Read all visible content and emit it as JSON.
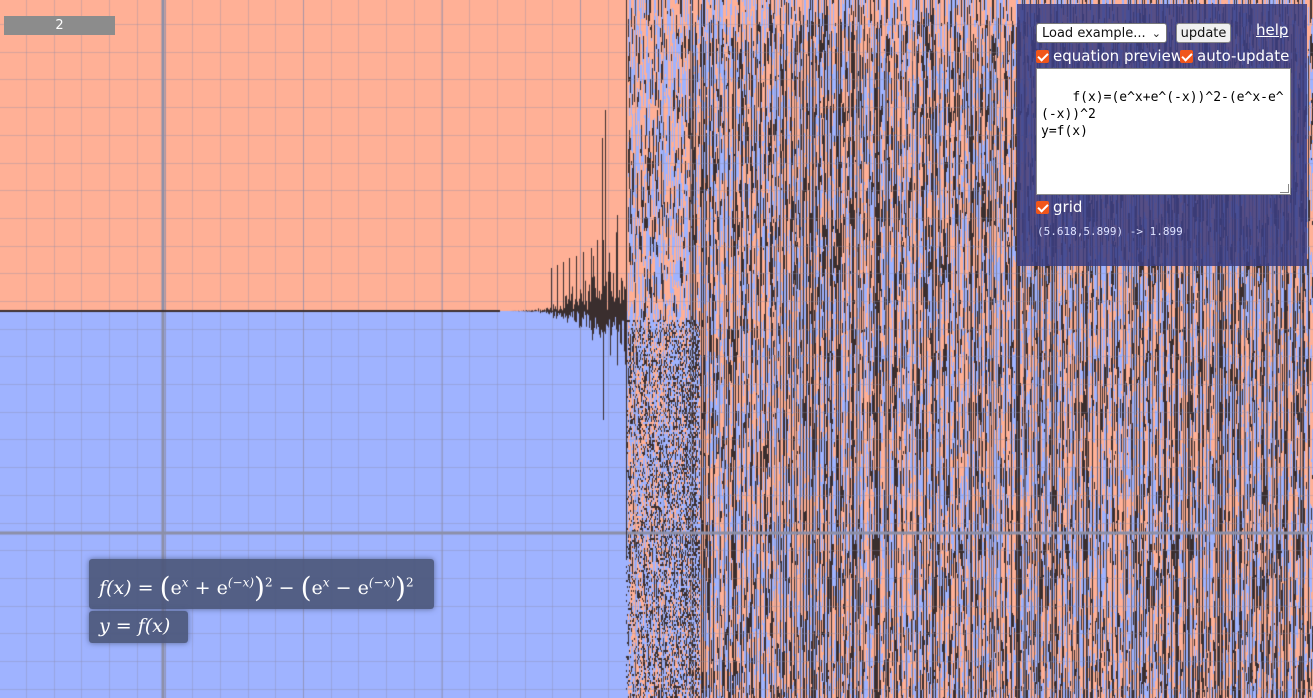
{
  "zoom_level": "2",
  "panel": {
    "example_select": "Load example...",
    "update_label": "update",
    "help_label": "help",
    "equation_preview_label": "equation preview",
    "equation_preview_checked": true,
    "auto_update_label": "auto-update",
    "auto_update_checked": true,
    "editor_text": "f(x)=(e^x+e^(-x))^2-(e^x-e^(-x))^2\ny=f(x)",
    "grid_label": "grid",
    "grid_checked": true,
    "coordinate_readout": "(5.618,5.899) -> 1.899"
  },
  "preview": {
    "line1": {
      "lhs": "f(x) =",
      "open": "(",
      "e1": "e",
      "e1_exp": "x",
      "plus": "+",
      "e2": "e",
      "e2_exp": "(−x)",
      "close": ")",
      "sq1": "2",
      "minus": "−",
      "open2": "(",
      "e3": "e",
      "e3_exp": "x",
      "minus2": "−",
      "e4": "e",
      "e4_exp": "(−x)",
      "close2": ")",
      "sq2": "2"
    },
    "line2": "y = f(x)"
  },
  "colors": {
    "above": "#ffb096",
    "below": "#9fb3ff",
    "curve": "#3a2e2e",
    "axis": "#8c8fa8",
    "panel": "#3a3e82",
    "checkbox": "#f0561b"
  }
}
